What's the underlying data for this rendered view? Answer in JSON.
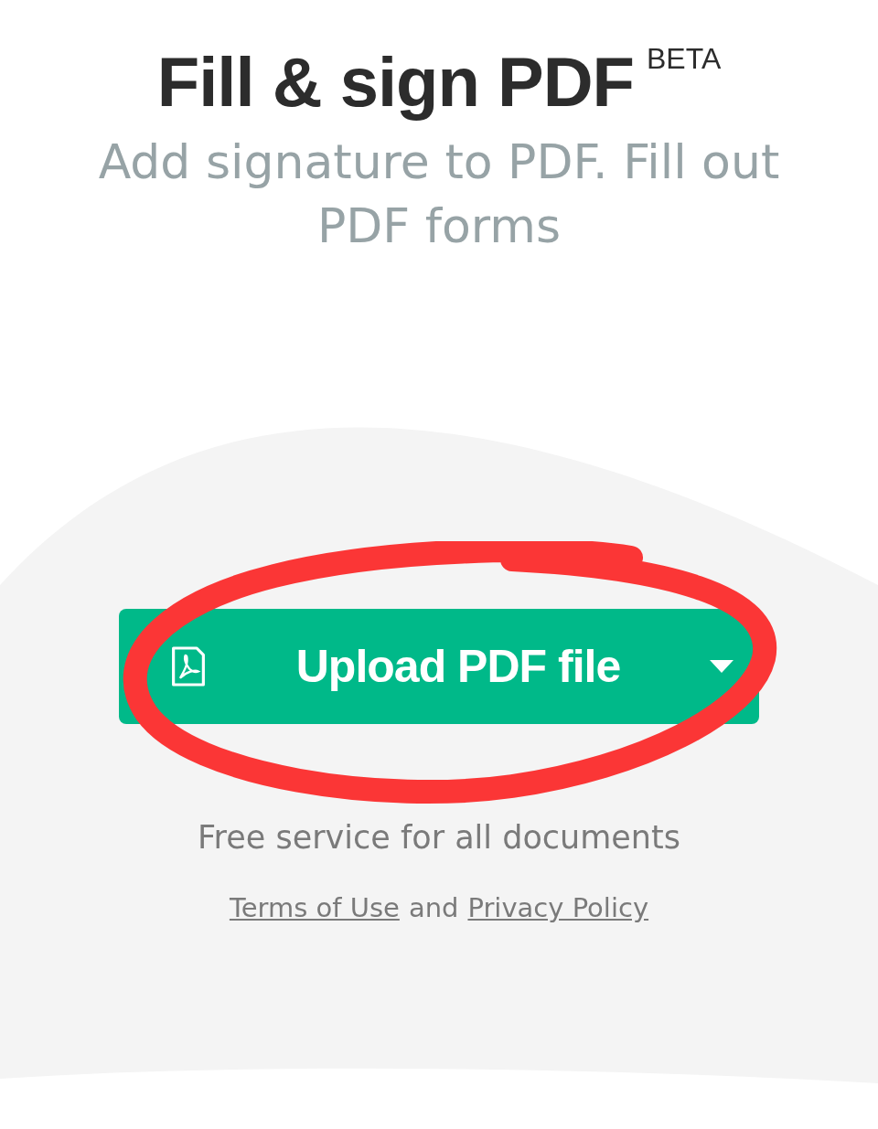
{
  "header": {
    "title": "Fill & sign PDF",
    "badge": "BETA",
    "subtitle": "Add signature to PDF. Fill out PDF forms"
  },
  "upload_button": {
    "label": "Upload PDF file"
  },
  "note": "Free service for all documents",
  "legal": {
    "terms_link": "Terms of Use",
    "joiner": "and",
    "privacy_link": "Privacy Policy"
  }
}
